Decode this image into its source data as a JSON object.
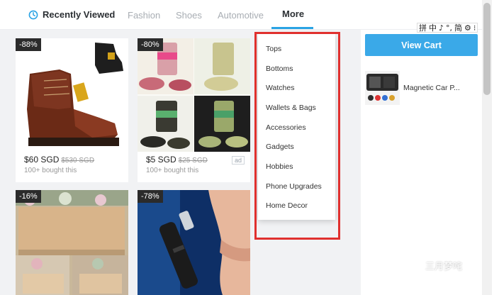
{
  "nav": {
    "tabs": [
      {
        "label": "Recently Viewed",
        "icon": "clock-icon"
      },
      {
        "label": "Fashion"
      },
      {
        "label": "Shoes"
      },
      {
        "label": "Automotive"
      },
      {
        "label": "More"
      }
    ]
  },
  "products": [
    {
      "discount": "-88%",
      "price": "$60 SGD",
      "old_price": "$530 SGD",
      "sold": "100+ bought this",
      "ad": ""
    },
    {
      "discount": "-80%",
      "price": "$5 SGD",
      "old_price": "$25 SGD",
      "sold": "100+ bought this",
      "ad": "ad"
    },
    {
      "discount": "-16%"
    },
    {
      "discount": "-78%"
    }
  ],
  "dropdown": {
    "items": [
      "Tops",
      "Bottoms",
      "Watches",
      "Wallets & Bags",
      "Accessories",
      "Gadgets",
      "Hobbies",
      "Phone Upgrades",
      "Home Decor"
    ]
  },
  "sidebar": {
    "view_cart": "View Cart",
    "item_title": "Magnetic Car P..."
  },
  "ime": {
    "chars": [
      "拼",
      "中",
      "♪",
      "°,",
      "简",
      "⚙",
      "⁝"
    ]
  },
  "watermark": {
    "text": "三月梦咤",
    "icon": "wechat-icon"
  },
  "colors": {
    "accent": "#2aa3e4",
    "cart_button": "#3aa9e8",
    "highlight_box": "#e0302e",
    "discount_badge": "#2b2b2b"
  }
}
